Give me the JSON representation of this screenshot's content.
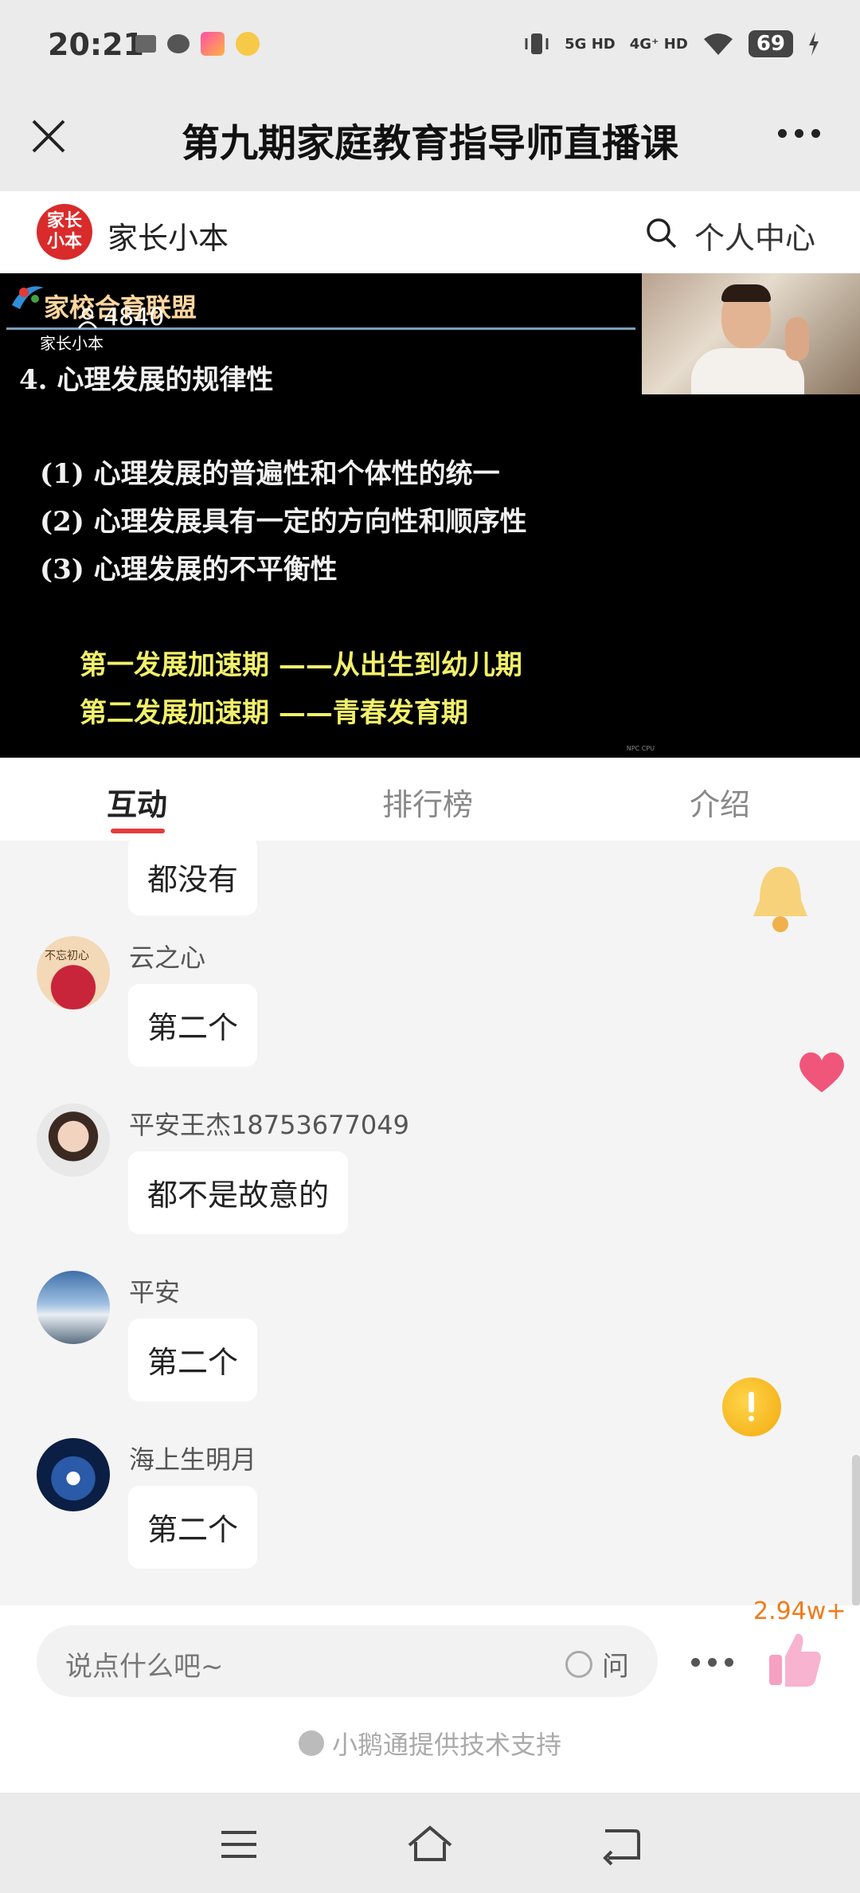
{
  "status_bar": {
    "time": "20:21",
    "network1": "5G HD",
    "network2": "4G⁺ HD",
    "battery": "69"
  },
  "header": {
    "title": "第九期家庭教育指导师直播课"
  },
  "brand": {
    "logo_text_top": "家长",
    "logo_text_bottom": "小本",
    "name": "家长小本",
    "personal_center": "个人中心"
  },
  "video": {
    "banner": "家校合育联盟",
    "viewer_count": "4840",
    "watermark": "家长小本",
    "slide_title": "4. 心理发展的规律性",
    "points": [
      "(1) 心理发展的普遍性和个体性的统一",
      "(2) 心理发展具有一定的方向性和顺序性",
      "(3) 心理发展的不平衡性"
    ],
    "highlights": [
      "第一发展加速期 ——从出生到幼儿期",
      "第二发展加速期 ——青春发育期"
    ],
    "small_text": "NPC CPU"
  },
  "tabs": [
    {
      "label": "互动",
      "active": true
    },
    {
      "label": "排行榜",
      "active": false
    },
    {
      "label": "介绍",
      "active": false
    }
  ],
  "messages": [
    {
      "user": "",
      "text": "都没有"
    },
    {
      "user": "云之心",
      "text": "第二个",
      "avatar_text": "不忘初心"
    },
    {
      "user": "平安王杰18753677049",
      "text": "都不是故意的"
    },
    {
      "user": "平安",
      "text": "第二个"
    },
    {
      "user": "海上生明月",
      "text": "第二个"
    }
  ],
  "input": {
    "placeholder": "说点什么吧~",
    "ask_label": "问",
    "like_count": "2.94w+"
  },
  "footer": {
    "powered_by": "小鹅通提供技术支持"
  },
  "colors": {
    "accent_red": "#e63b3b",
    "like_orange": "#f07a1a",
    "slide_yellow": "#f1f06a"
  }
}
